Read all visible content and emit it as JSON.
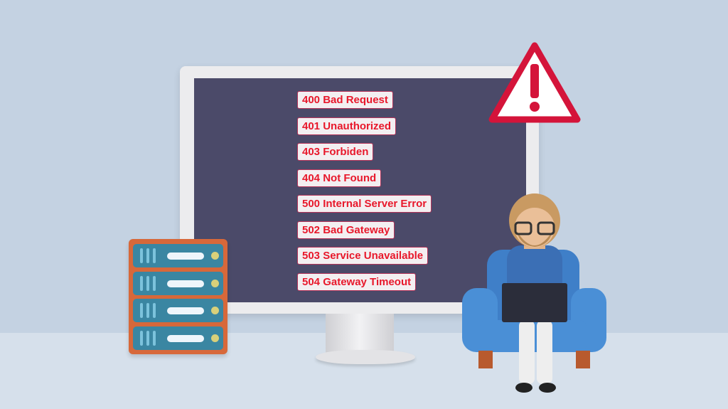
{
  "error_codes": [
    {
      "label": "400 Bad Request"
    },
    {
      "label": "401 Unauthorized"
    },
    {
      "label": "403 Forbiden"
    },
    {
      "label": "404 Not Found"
    },
    {
      "label": "500 Internal Server Error"
    },
    {
      "label": "502 Bad Gateway"
    },
    {
      "label": "503 Service Unavailable"
    },
    {
      "label": "504 Gateway Timeout"
    }
  ],
  "colors": {
    "background": "#c4d2e2",
    "screen": "#4b4a69",
    "error_text": "#e8182b",
    "server": "#d7683a",
    "server_unit": "#3a86a2",
    "chair": "#4a8fd6"
  },
  "icons": [
    "warning-icon",
    "server-rack-icon",
    "monitor-icon",
    "person-with-laptop-illustration"
  ]
}
